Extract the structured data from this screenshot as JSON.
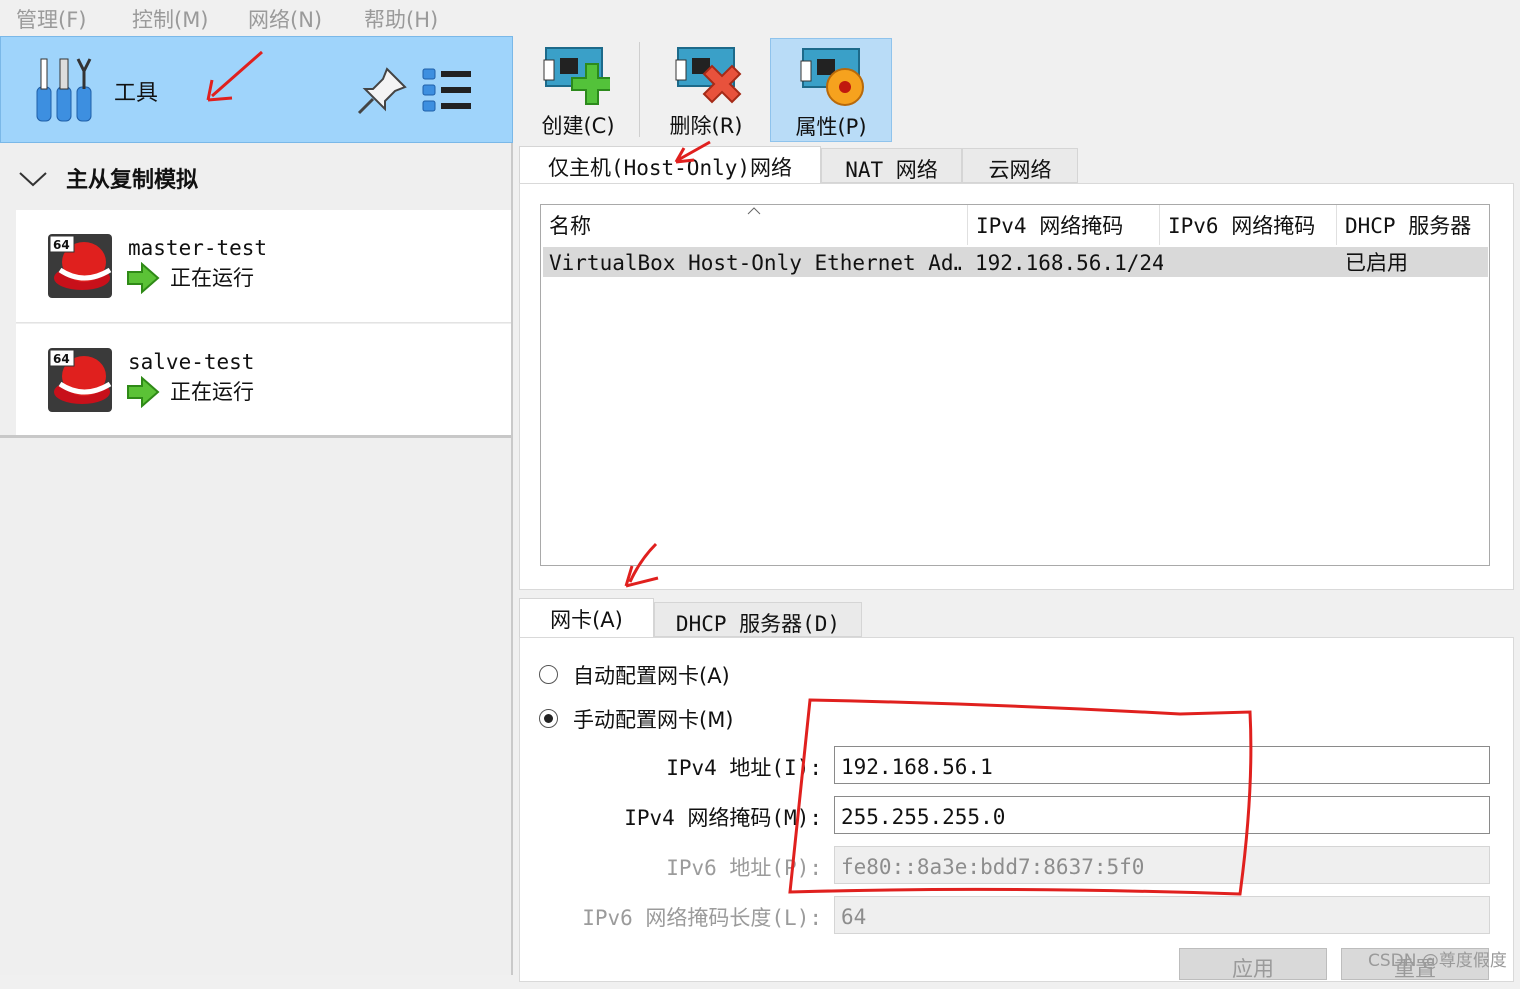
{
  "menu": [
    "管理(F)",
    "控制(M)",
    "网络(N)",
    "帮助(H)"
  ],
  "left": {
    "tools_label": "工具",
    "group_label": "主从复制模拟",
    "vms": [
      {
        "name": "master-test",
        "state": "正在运行",
        "badge": "64"
      },
      {
        "name": "salve-test",
        "state": "正在运行",
        "badge": "64"
      }
    ]
  },
  "toolbar": {
    "create": "创建(C)",
    "delete": "删除(R)",
    "properties": "属性(P)"
  },
  "tabs": [
    "仅主机(Host-Only)网络",
    "NAT 网络",
    "云网络"
  ],
  "table": {
    "headers": [
      "名称",
      "IPv4 网络掩码",
      "IPv6 网络掩码",
      "DHCP 服务器"
    ],
    "rows": [
      [
        "VirtualBox Host-Only Ethernet Ad…",
        "192.168.56.1/24",
        "",
        "已启用"
      ]
    ]
  },
  "detail_tabs": [
    "网卡(A)",
    "DHCP 服务器(D)"
  ],
  "form": {
    "auto_label": "自动配置网卡(A)",
    "manual_label": "手动配置网卡(M)",
    "ipv4_addr_label": "IPv4 地址(I):",
    "ipv4_addr_value": "192.168.56.1",
    "ipv4_mask_label": "IPv4 网络掩码(M):",
    "ipv4_mask_value": "255.255.255.0",
    "ipv6_addr_label": "IPv6 地址(P):",
    "ipv6_addr_value": "fe80::8a3e:bdd7:8637:5f0",
    "ipv6_prefix_label": "IPv6 网络掩码长度(L):",
    "ipv6_prefix_value": "64"
  },
  "buttons": {
    "apply": "应用",
    "reset": "重置"
  },
  "watermark": "CSDN @尊度假度",
  "colors": {
    "selection": "#9fd4fb",
    "annotation": "#e0201e"
  }
}
